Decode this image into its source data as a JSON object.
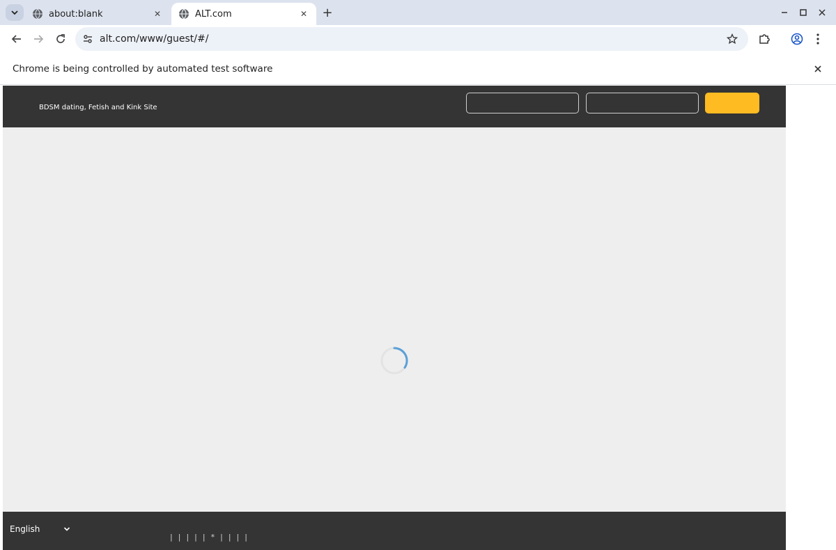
{
  "browser": {
    "tabs": [
      {
        "title": "about:blank",
        "active": false
      },
      {
        "title": "ALT.com",
        "active": true
      }
    ],
    "new_tab_label": "+",
    "url": "alt.com/www/guest/#/",
    "infobar_text": "Chrome is being controlled by automated test software",
    "icons": {
      "tab_search": "chevron-down-icon",
      "favicon": "globe-icon",
      "back": "arrow-left-icon",
      "forward": "arrow-right-icon",
      "reload": "reload-icon",
      "site_info": "tune-icon",
      "bookmark": "star-icon",
      "extensions": "puzzle-icon",
      "profile": "account-icon",
      "menu": "more-vertical-icon"
    }
  },
  "site": {
    "tagline": "BDSM dating, Fetish and Kink Site",
    "login": {
      "username_value": "",
      "password_value": "",
      "button_label": ""
    },
    "footer": {
      "language": "English",
      "links": [
        "|",
        "|",
        "|",
        "|",
        "|",
        "*",
        "|",
        "|",
        "|",
        "|"
      ]
    },
    "colors": {
      "header_bg": "#343434",
      "page_bg": "#eeeeee",
      "accent": "#ffbb22",
      "spinner": "#5aa0d8"
    }
  }
}
